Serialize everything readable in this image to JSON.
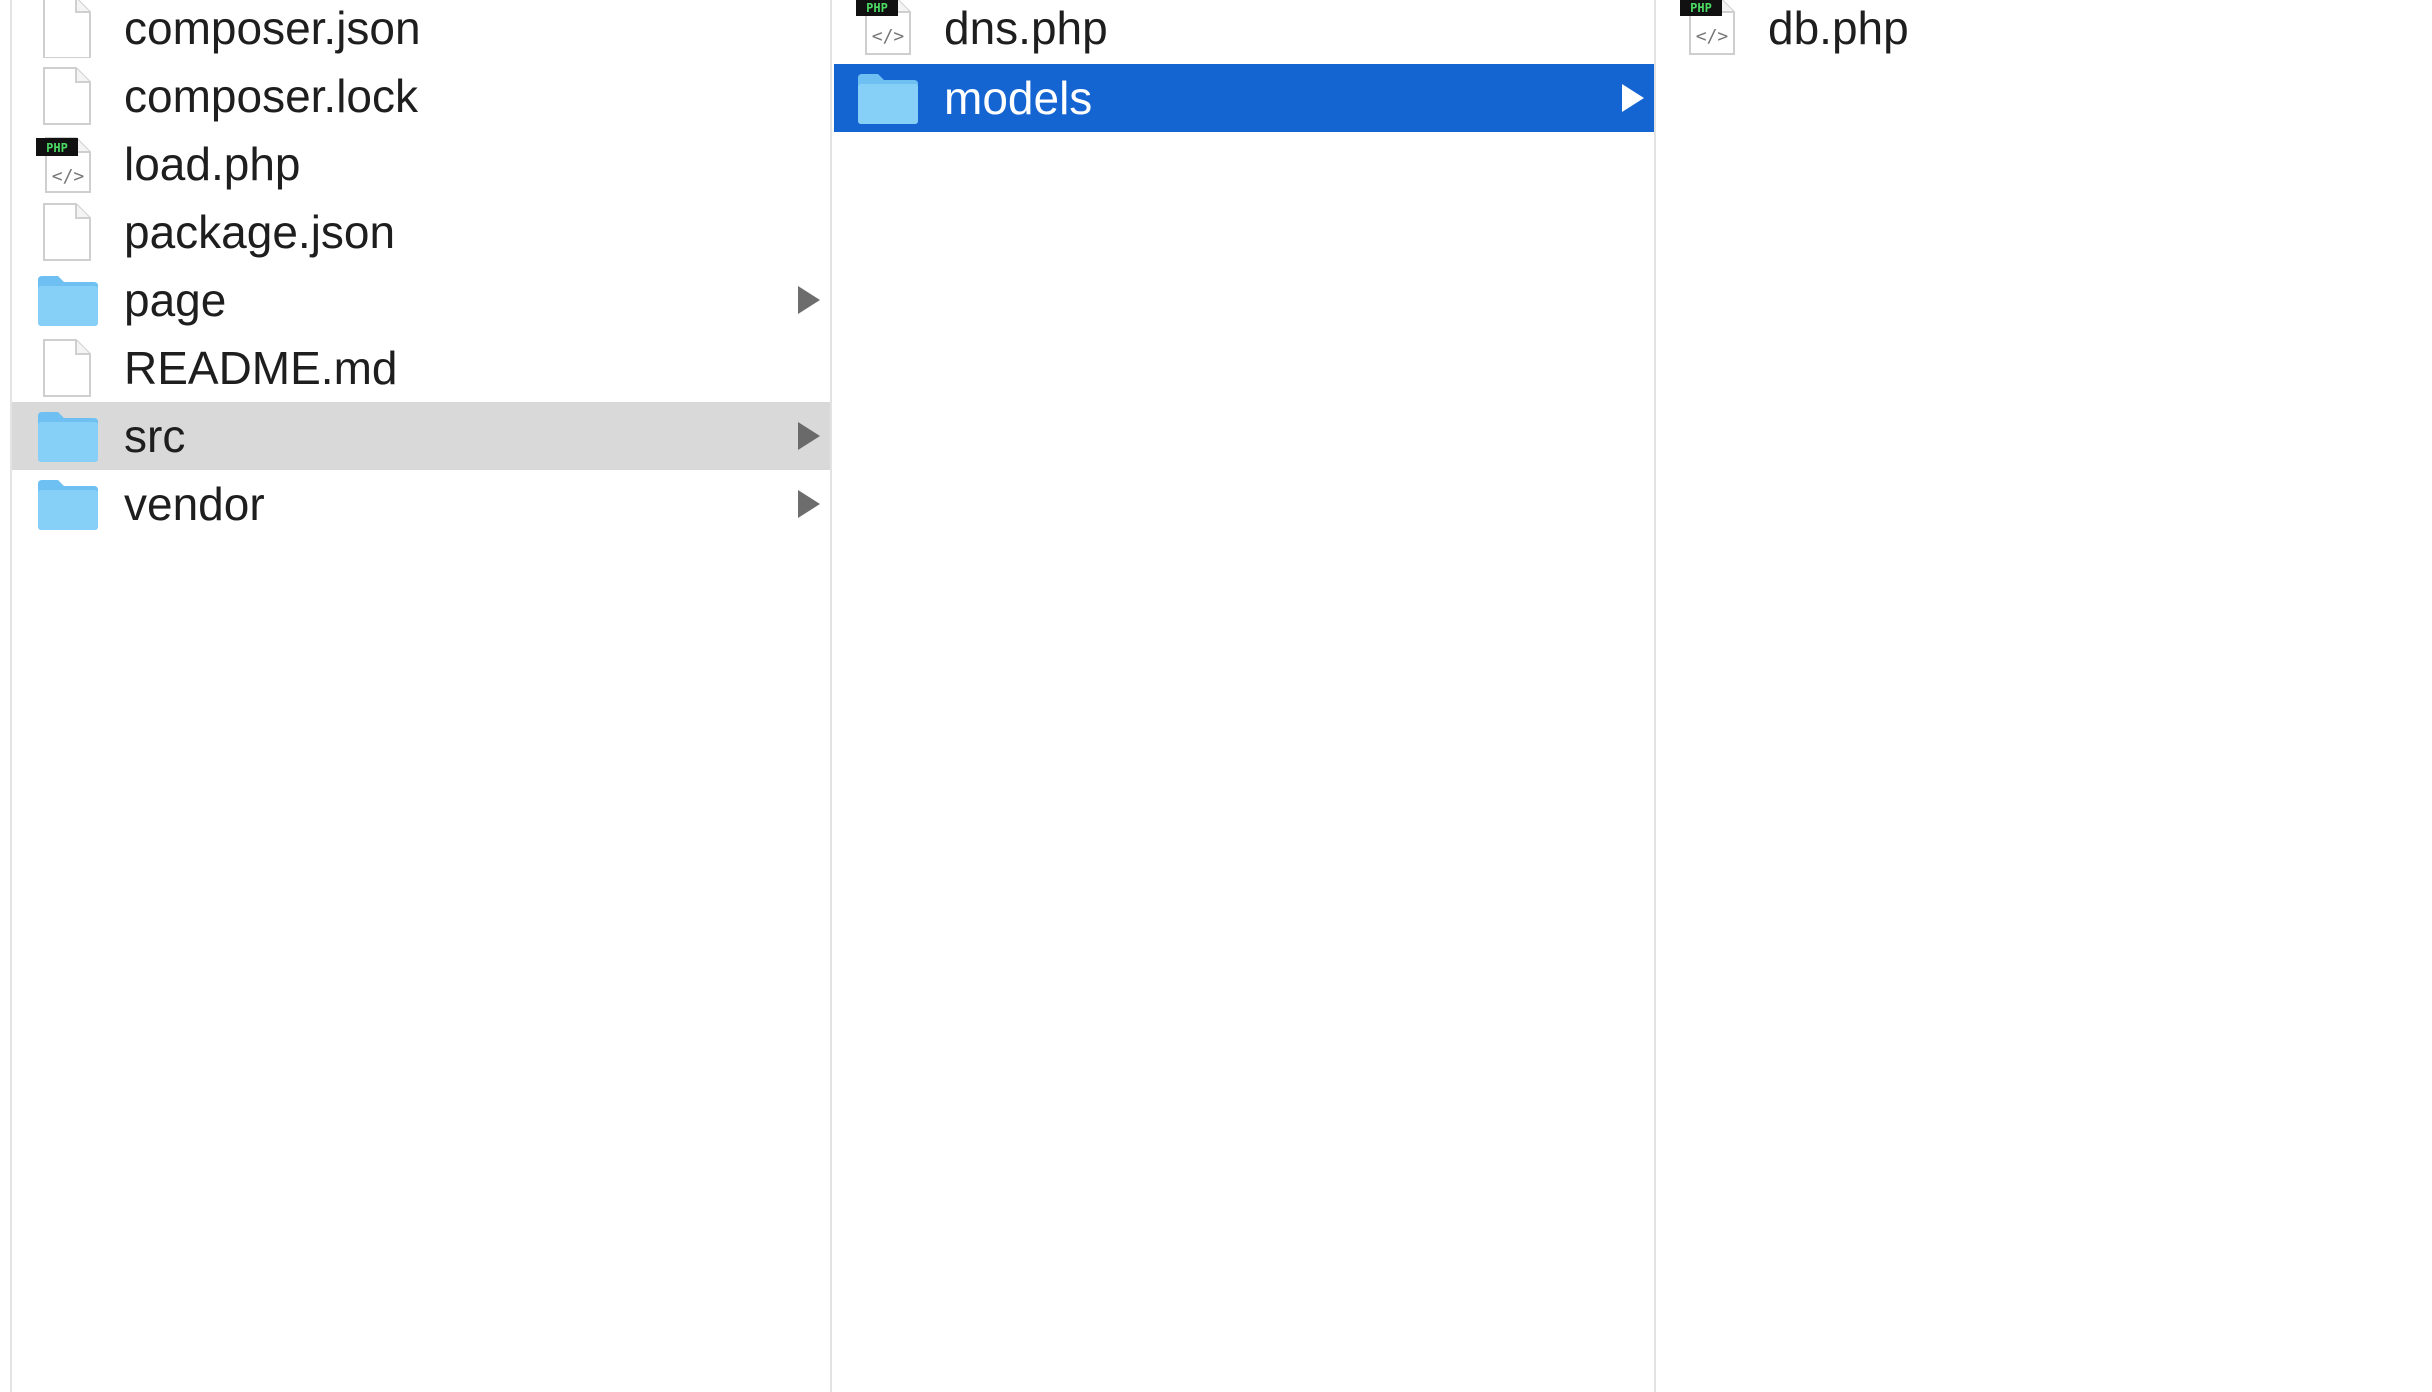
{
  "columns": [
    {
      "items": [
        {
          "name": "composer.json",
          "type": "file",
          "icon": "document-icon"
        },
        {
          "name": "composer.lock",
          "type": "file",
          "icon": "document-icon"
        },
        {
          "name": "load.php",
          "type": "php",
          "icon": "php-file-icon"
        },
        {
          "name": "package.json",
          "type": "file",
          "icon": "document-icon"
        },
        {
          "name": "page",
          "type": "folder",
          "icon": "folder-icon"
        },
        {
          "name": "README.md",
          "type": "file",
          "icon": "document-icon"
        },
        {
          "name": "src",
          "type": "folder",
          "icon": "folder-icon",
          "selected": "inactive"
        },
        {
          "name": "vendor",
          "type": "folder",
          "icon": "folder-icon"
        }
      ]
    },
    {
      "items": [
        {
          "name": "dns.php",
          "type": "php",
          "icon": "php-file-icon"
        },
        {
          "name": "models",
          "type": "folder",
          "icon": "folder-icon",
          "selected": "active"
        }
      ]
    },
    {
      "items": [
        {
          "name": "db.php",
          "type": "php",
          "icon": "php-file-icon"
        }
      ]
    }
  ],
  "php_badge_text": "PHP",
  "colors": {
    "selection_active": "#1464d2",
    "selection_inactive": "#d9d9d9",
    "folder": "#7ccaf6",
    "text": "#1e1e1e"
  }
}
